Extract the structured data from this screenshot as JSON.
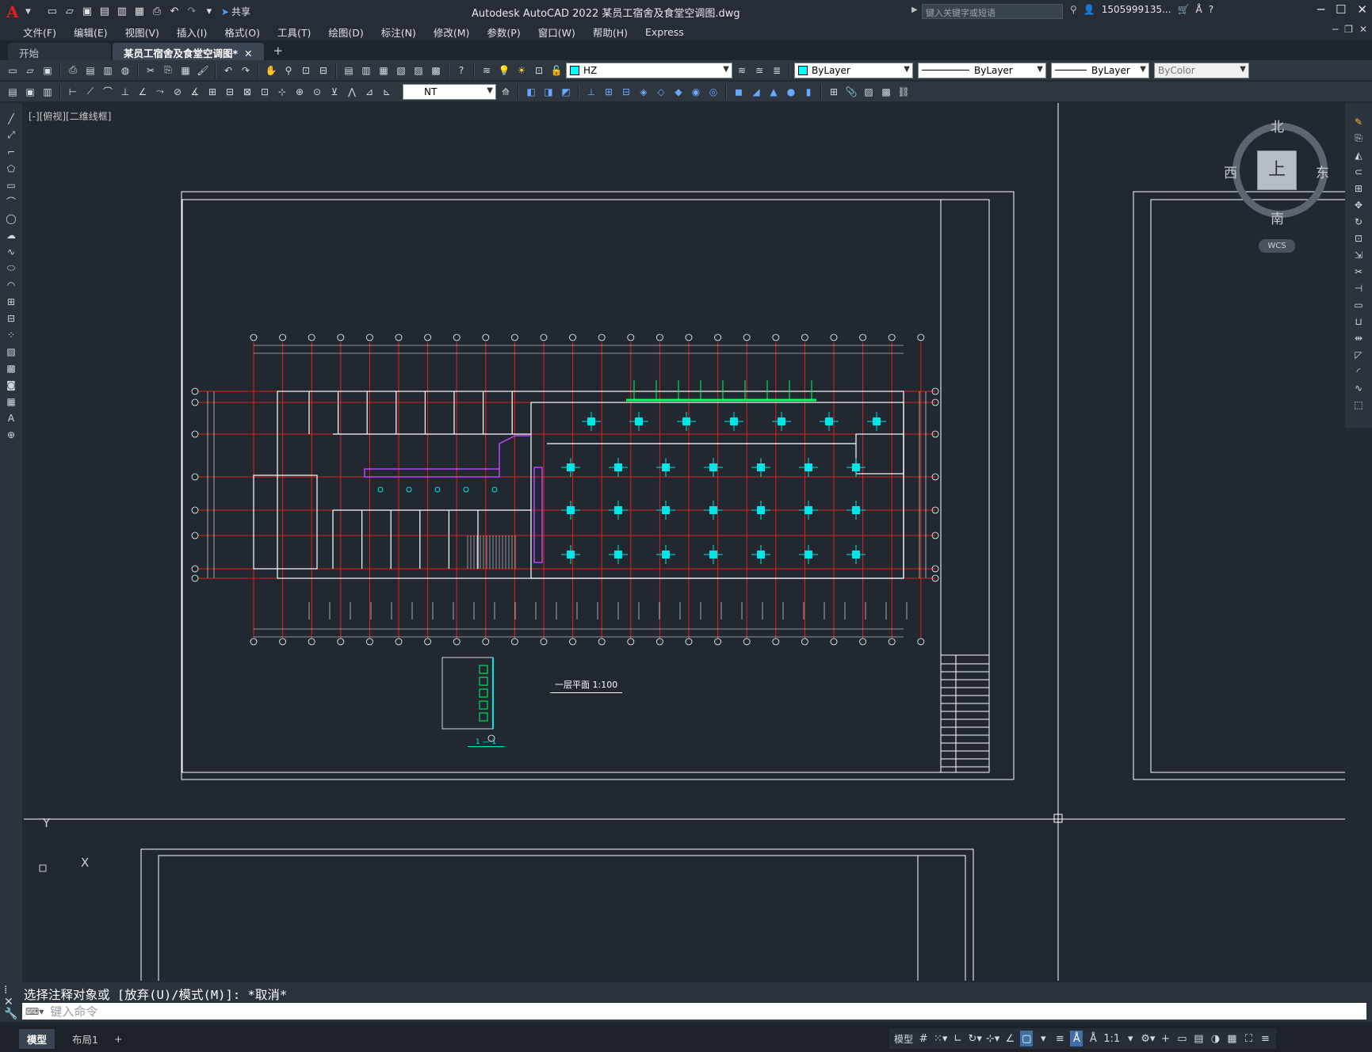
{
  "titlebar": {
    "app_logo": "A",
    "share_label": "共享",
    "title": "Autodesk AutoCAD 2022    某员工宿舍及食堂空调图.dwg",
    "search_placeholder": "键入关键字或短语",
    "user": "1505999135...",
    "qat_icons": [
      "new-icon",
      "open-icon",
      "save-icon",
      "saveas-icon",
      "open-web-icon",
      "save-web-icon",
      "plot-icon",
      "undo-icon",
      "redo-icon",
      "workspace-icon"
    ]
  },
  "menubar": {
    "items": [
      "文件(F)",
      "编辑(E)",
      "视图(V)",
      "插入(I)",
      "格式(O)",
      "工具(T)",
      "绘图(D)",
      "标注(N)",
      "修改(M)",
      "参数(P)",
      "窗口(W)",
      "帮助(H)",
      "Express"
    ]
  },
  "tabs": {
    "start": "开始",
    "doc": "某员工宿舍及食堂空调图*"
  },
  "toolbar1": {
    "layer_name": "HZ",
    "color": "ByLayer",
    "linetype": "ByLayer",
    "lineweight": "ByLayer",
    "plotstyle": "ByColor"
  },
  "toolbar2": {
    "textstyle": "NT"
  },
  "viewport": {
    "label": "[-][俯视][二维线框]"
  },
  "viewcube": {
    "north": "北",
    "south": "南",
    "east": "东",
    "west": "西",
    "face": "上",
    "wcs": "WCS"
  },
  "drawing": {
    "plan_title": "一层平面 1:100",
    "section_title": "1 — 1",
    "ucs_x": "X",
    "ucs_y": "Y"
  },
  "command": {
    "history": "选择注释对象或 [放弃(U)/模式(M)]: *取消*",
    "placeholder": "键入命令"
  },
  "statusbar": {
    "model_tab": "模型",
    "layout_tab": "布局1",
    "model_btn": "模型",
    "scale": "1:1"
  },
  "colors": {
    "background": "#212830",
    "axis_red": "#e02020",
    "wall_white": "#ffffff",
    "duct_cyan": "#00e5e5",
    "diffuser_green": "#00ff66"
  }
}
